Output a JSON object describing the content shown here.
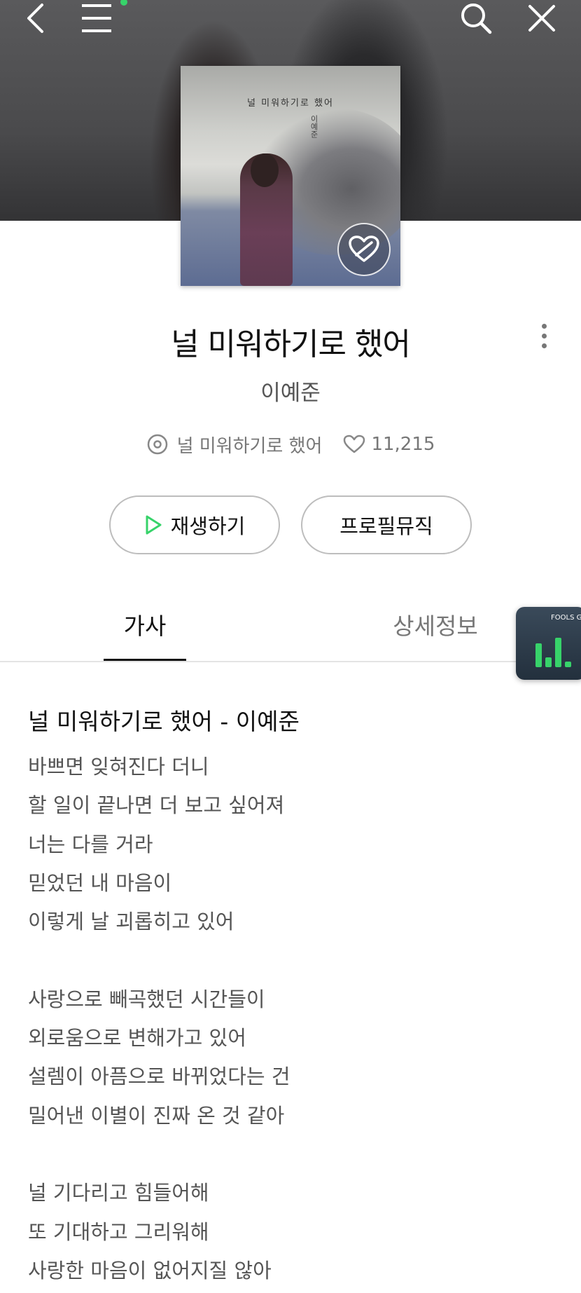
{
  "header": {
    "back_icon": "chevron-left-icon",
    "menu_icon": "menu-icon",
    "search_icon": "search-icon",
    "close_icon": "close-icon",
    "notify_color": "#37d36a"
  },
  "album_art": {
    "cover_title": "널 미워하기로 했어",
    "cover_artist": "이예준",
    "like_badge_icon": "heart-badge-icon"
  },
  "song": {
    "title": "널 미워하기로 했어",
    "artist": "이예준",
    "album": "널 미워하기로 했어",
    "likes": "11,215"
  },
  "actions": {
    "play_label": "재생하기",
    "profile_label": "프로필뮤직"
  },
  "tabs": [
    {
      "label": "가사",
      "active": true
    },
    {
      "label": "상세정보",
      "active": false
    }
  ],
  "mini_player": {
    "label": "FOOLS GARDE",
    "accent": "#37d36a"
  },
  "lyrics": {
    "heading": "널 미워하기로 했어 - 이예준",
    "lines": [
      "바쁘면 잊혀진다 더니",
      "할 일이 끝나면 더 보고 싶어져",
      "너는 다를 거라",
      "믿었던 내 마음이",
      "이렇게 날 괴롭히고 있어",
      "",
      "사랑으로 빼곡했던 시간들이",
      "외로움으로 변해가고 있어",
      "설렘이 아픔으로 바뀌었다는 건",
      "밀어낸 이별이 진짜 온 것 같아",
      "",
      "널 기다리고 힘들어해",
      "또 기대하고 그리워해",
      "사랑한 마음이 없어지질 않아"
    ]
  }
}
